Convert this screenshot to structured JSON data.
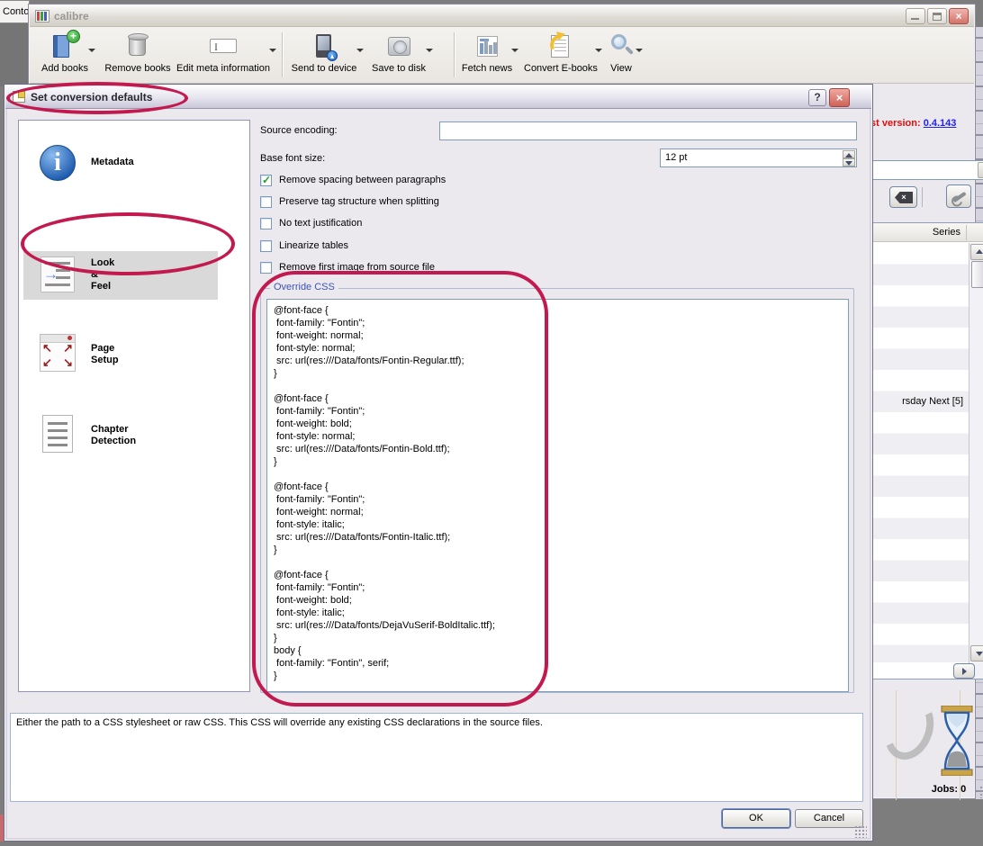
{
  "background": {
    "tab_label": "Contou",
    "desktop_color": "#7d7d7d"
  },
  "main_window": {
    "title": "calibre",
    "toolbar": {
      "buttons": [
        {
          "label": "Add books",
          "icon": "add-books",
          "has_dropdown": true
        },
        {
          "label": "Remove books",
          "icon": "remove-books",
          "has_dropdown": false
        },
        {
          "label": "Edit meta information",
          "icon": "edit-meta-information",
          "has_dropdown": true
        },
        {
          "label": "Send to device",
          "icon": "send-to-device",
          "has_dropdown": true
        },
        {
          "label": "Save to disk",
          "icon": "save-to-disk",
          "has_dropdown": true
        },
        {
          "label": "Fetch news",
          "icon": "fetch-news",
          "has_dropdown": true
        },
        {
          "label": "Convert E-books",
          "icon": "convert-ebooks",
          "has_dropdown": true
        },
        {
          "label": "View",
          "icon": "view",
          "has_dropdown": true
        }
      ]
    },
    "update_notice": {
      "prefix": "st version:",
      "version": "0.4.143"
    },
    "library_panel": {
      "series_column_header": "Series",
      "visible_row_text": "rsday Next [5]"
    },
    "status_bar": {
      "jobs_label": "Jobs: 0"
    }
  },
  "dialog": {
    "title": "Set conversion defaults",
    "sidebar": {
      "items": [
        {
          "label": "Metadata",
          "icon": "metadata-info",
          "selected": false
        },
        {
          "label": "Look\n&\nFeel",
          "icon": "look-and-feel",
          "selected": true
        },
        {
          "label": "Page\nSetup",
          "icon": "page-setup",
          "selected": false
        },
        {
          "label": "Chapter\nDetection",
          "icon": "chapter-detection",
          "selected": false
        }
      ]
    },
    "fields": {
      "source_encoding_label": "Source encoding:",
      "source_encoding_value": "",
      "base_font_size_label": "Base font size:",
      "base_font_size_value": "12 pt"
    },
    "checkboxes": [
      {
        "label": "Remove spacing between paragraphs",
        "checked": true
      },
      {
        "label": "Preserve tag structure when splitting",
        "checked": false
      },
      {
        "label": "No text justification",
        "checked": false
      },
      {
        "label": "Linearize tables",
        "checked": false
      },
      {
        "label": "Remove first image from source file",
        "checked": false
      }
    ],
    "override_css": {
      "group_label": "Override CSS",
      "content": "@font-face {\n font-family: \"Fontin\";\n font-weight: normal;\n font-style: normal;\n src: url(res:///Data/fonts/Fontin-Regular.ttf);\n}\n\n@font-face {\n font-family: \"Fontin\";\n font-weight: bold;\n font-style: normal;\n src: url(res:///Data/fonts/Fontin-Bold.ttf);\n}\n\n@font-face {\n font-family: \"Fontin\";\n font-weight: normal;\n font-style: italic;\n src: url(res:///Data/fonts/Fontin-Italic.ttf);\n}\n\n@font-face {\n font-family: \"Fontin\";\n font-weight: bold;\n font-style: italic;\n src: url(res:///Data/fonts/DejaVuSerif-BoldItalic.ttf);\n}\nbody {\n font-family: \"Fontin\", serif;\n}"
    },
    "help_text": "Either the path to a CSS stylesheet or raw CSS. This CSS will override any existing CSS declarations in the source files.",
    "buttons": {
      "ok": "OK",
      "cancel": "Cancel"
    }
  },
  "annotations": {
    "color": "#c2194e"
  }
}
